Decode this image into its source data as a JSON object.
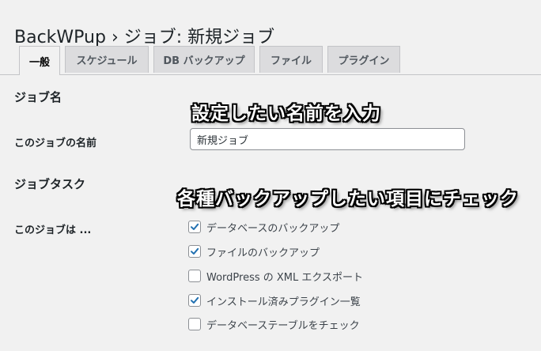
{
  "page": {
    "title": "BackWPup › ジョブ: 新規ジョブ"
  },
  "tabs": [
    {
      "label": "一般",
      "active": true
    },
    {
      "label": "スケジュール",
      "active": false
    },
    {
      "label": "DB バックアップ",
      "active": false
    },
    {
      "label": "ファイル",
      "active": false
    },
    {
      "label": "プラグイン",
      "active": false
    }
  ],
  "job_name_section": {
    "title": "ジョブ名",
    "field_label": "このジョブの名前",
    "field_value": "新規ジョブ"
  },
  "job_tasks_section": {
    "title": "ジョブタスク",
    "field_label": "このジョブは ...",
    "options": [
      {
        "label": "データベースのバックアップ",
        "checked": true
      },
      {
        "label": "ファイルのバックアップ",
        "checked": true
      },
      {
        "label": "WordPress の XML エクスポート",
        "checked": false
      },
      {
        "label": "インストール済みプラグイン一覧",
        "checked": true
      },
      {
        "label": "データベーステーブルをチェック",
        "checked": false
      }
    ]
  },
  "annotations": {
    "name_hint": "設定したい名前を入力",
    "tasks_hint": "各種バックアップしたい項目にチェック"
  },
  "colors": {
    "background": "#f1f1f1",
    "checkmark": "#2271b1",
    "tab_inactive": "#dcdcde"
  }
}
